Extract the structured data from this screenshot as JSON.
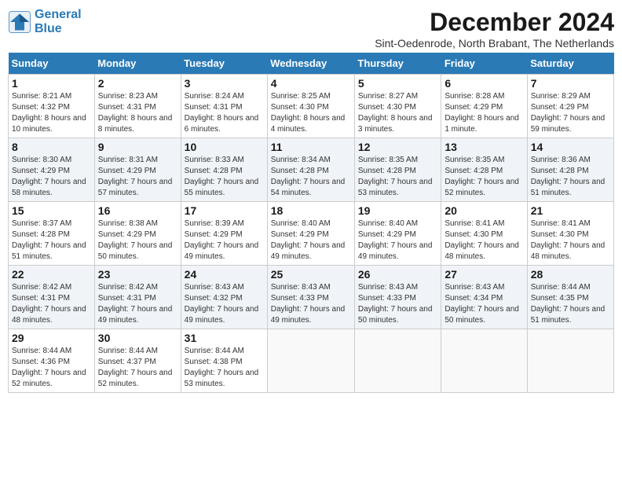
{
  "header": {
    "logo_line1": "General",
    "logo_line2": "Blue",
    "title": "December 2024",
    "subtitle": "Sint-Oedenrode, North Brabant, The Netherlands"
  },
  "weekdays": [
    "Sunday",
    "Monday",
    "Tuesday",
    "Wednesday",
    "Thursday",
    "Friday",
    "Saturday"
  ],
  "weeks": [
    [
      {
        "day": "1",
        "sunrise": "8:21 AM",
        "sunset": "4:32 PM",
        "daylight": "8 hours and 10 minutes."
      },
      {
        "day": "2",
        "sunrise": "8:23 AM",
        "sunset": "4:31 PM",
        "daylight": "8 hours and 8 minutes."
      },
      {
        "day": "3",
        "sunrise": "8:24 AM",
        "sunset": "4:31 PM",
        "daylight": "8 hours and 6 minutes."
      },
      {
        "day": "4",
        "sunrise": "8:25 AM",
        "sunset": "4:30 PM",
        "daylight": "8 hours and 4 minutes."
      },
      {
        "day": "5",
        "sunrise": "8:27 AM",
        "sunset": "4:30 PM",
        "daylight": "8 hours and 3 minutes."
      },
      {
        "day": "6",
        "sunrise": "8:28 AM",
        "sunset": "4:29 PM",
        "daylight": "8 hours and 1 minute."
      },
      {
        "day": "7",
        "sunrise": "8:29 AM",
        "sunset": "4:29 PM",
        "daylight": "7 hours and 59 minutes."
      }
    ],
    [
      {
        "day": "8",
        "sunrise": "8:30 AM",
        "sunset": "4:29 PM",
        "daylight": "7 hours and 58 minutes."
      },
      {
        "day": "9",
        "sunrise": "8:31 AM",
        "sunset": "4:29 PM",
        "daylight": "7 hours and 57 minutes."
      },
      {
        "day": "10",
        "sunrise": "8:33 AM",
        "sunset": "4:28 PM",
        "daylight": "7 hours and 55 minutes."
      },
      {
        "day": "11",
        "sunrise": "8:34 AM",
        "sunset": "4:28 PM",
        "daylight": "7 hours and 54 minutes."
      },
      {
        "day": "12",
        "sunrise": "8:35 AM",
        "sunset": "4:28 PM",
        "daylight": "7 hours and 53 minutes."
      },
      {
        "day": "13",
        "sunrise": "8:35 AM",
        "sunset": "4:28 PM",
        "daylight": "7 hours and 52 minutes."
      },
      {
        "day": "14",
        "sunrise": "8:36 AM",
        "sunset": "4:28 PM",
        "daylight": "7 hours and 51 minutes."
      }
    ],
    [
      {
        "day": "15",
        "sunrise": "8:37 AM",
        "sunset": "4:28 PM",
        "daylight": "7 hours and 51 minutes."
      },
      {
        "day": "16",
        "sunrise": "8:38 AM",
        "sunset": "4:29 PM",
        "daylight": "7 hours and 50 minutes."
      },
      {
        "day": "17",
        "sunrise": "8:39 AM",
        "sunset": "4:29 PM",
        "daylight": "7 hours and 49 minutes."
      },
      {
        "day": "18",
        "sunrise": "8:40 AM",
        "sunset": "4:29 PM",
        "daylight": "7 hours and 49 minutes."
      },
      {
        "day": "19",
        "sunrise": "8:40 AM",
        "sunset": "4:29 PM",
        "daylight": "7 hours and 49 minutes."
      },
      {
        "day": "20",
        "sunrise": "8:41 AM",
        "sunset": "4:30 PM",
        "daylight": "7 hours and 48 minutes."
      },
      {
        "day": "21",
        "sunrise": "8:41 AM",
        "sunset": "4:30 PM",
        "daylight": "7 hours and 48 minutes."
      }
    ],
    [
      {
        "day": "22",
        "sunrise": "8:42 AM",
        "sunset": "4:31 PM",
        "daylight": "7 hours and 48 minutes."
      },
      {
        "day": "23",
        "sunrise": "8:42 AM",
        "sunset": "4:31 PM",
        "daylight": "7 hours and 49 minutes."
      },
      {
        "day": "24",
        "sunrise": "8:43 AM",
        "sunset": "4:32 PM",
        "daylight": "7 hours and 49 minutes."
      },
      {
        "day": "25",
        "sunrise": "8:43 AM",
        "sunset": "4:33 PM",
        "daylight": "7 hours and 49 minutes."
      },
      {
        "day": "26",
        "sunrise": "8:43 AM",
        "sunset": "4:33 PM",
        "daylight": "7 hours and 50 minutes."
      },
      {
        "day": "27",
        "sunrise": "8:43 AM",
        "sunset": "4:34 PM",
        "daylight": "7 hours and 50 minutes."
      },
      {
        "day": "28",
        "sunrise": "8:44 AM",
        "sunset": "4:35 PM",
        "daylight": "7 hours and 51 minutes."
      }
    ],
    [
      {
        "day": "29",
        "sunrise": "8:44 AM",
        "sunset": "4:36 PM",
        "daylight": "7 hours and 52 minutes."
      },
      {
        "day": "30",
        "sunrise": "8:44 AM",
        "sunset": "4:37 PM",
        "daylight": "7 hours and 52 minutes."
      },
      {
        "day": "31",
        "sunrise": "8:44 AM",
        "sunset": "4:38 PM",
        "daylight": "7 hours and 53 minutes."
      },
      null,
      null,
      null,
      null
    ]
  ]
}
